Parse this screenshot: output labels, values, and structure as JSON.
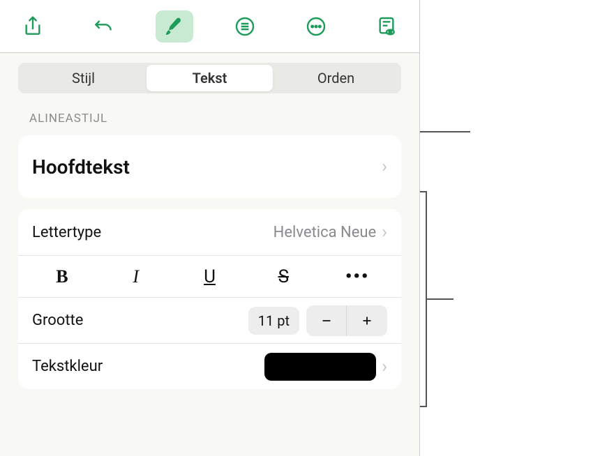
{
  "toolbar": {
    "share": "share",
    "undo": "undo",
    "format": "format",
    "list": "list",
    "more": "more",
    "readmode": "readmode"
  },
  "tabs": {
    "items": [
      {
        "label": "Stijl",
        "active": false
      },
      {
        "label": "Tekst",
        "active": true
      },
      {
        "label": "Orden",
        "active": false
      }
    ]
  },
  "sectionHeader": "ALINEASTIJL",
  "paragraphStyle": "Hoofdtekst",
  "fontRow": {
    "label": "Lettertype",
    "value": "Helvetica Neue"
  },
  "formatButtons": {
    "bold": "B",
    "italic": "I",
    "underline": "U",
    "strike": "S",
    "more": "•••"
  },
  "sizeRow": {
    "label": "Grootte",
    "value": "11 pt"
  },
  "colorRow": {
    "label": "Tekstkleur",
    "swatch": "#000000"
  }
}
